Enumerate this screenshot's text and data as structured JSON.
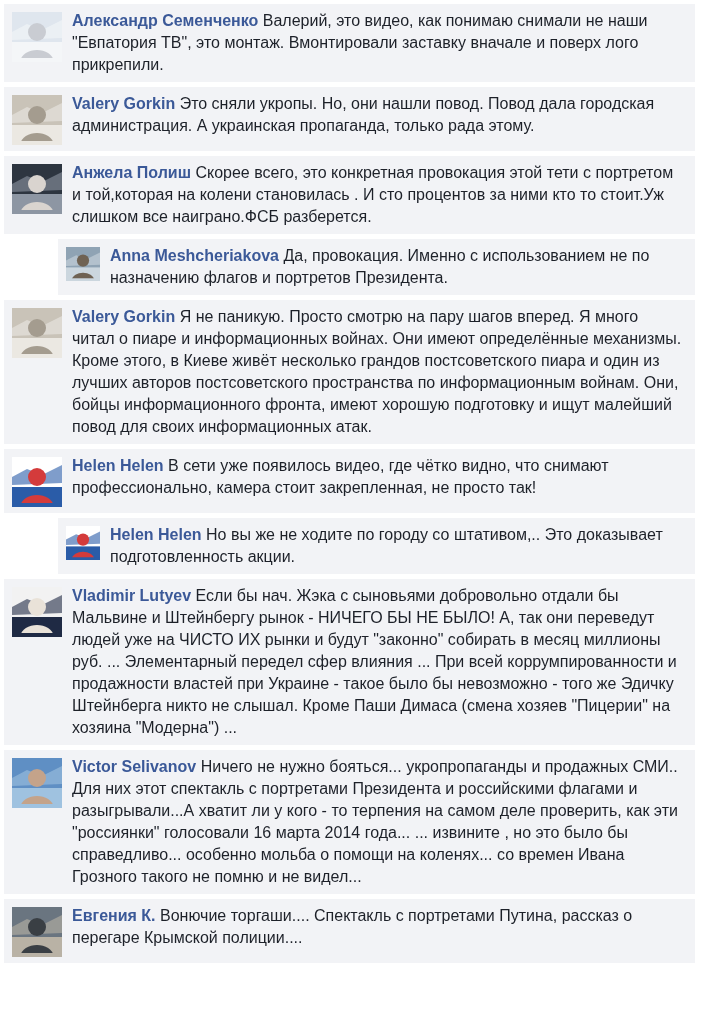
{
  "comments": [
    {
      "author": "Александр Семенченко",
      "text": "Валерий, это видео, как понимаю снимали не наши \"Евпатория ТВ\", это монтаж. Вмонтировали заставку вначале и поверх лого прикрепили.",
      "reply": false
    },
    {
      "author": "Valery Gorkin",
      "text": "Это сняли укропы. Но, они нашли повод. Повод дала городская администрация. А украинская пропаганда, только рада этому.",
      "reply": false
    },
    {
      "author": "Анжела Полиш",
      "text": "Скорее всего, это конкретная провокация этой тети с портретом и той,которая на колени становилась . И сто процентов за ними кто то стоит.Уж слишком все наиграно.ФСБ разберется.",
      "reply": false
    },
    {
      "author": "Anna Meshcheriakova",
      "text": "Да, провокация. Именно с использованием не по назначению флагов и портретов Президента.",
      "reply": true
    },
    {
      "author": "Valery Gorkin",
      "text": "Я не паникую. Просто смотрю на пару шагов вперед. Я много читал о пиаре и информационных войнах. Они имеют определённые механизмы. Кроме этого, в Киеве живёт несколько грандов постсоветского пиара и один из лучших авторов постсоветского пространства по информационным войнам. Они, бойцы информационного фронта, имеют хорошую подготовку и ищут малейший повод для своих информационных атак.",
      "reply": false
    },
    {
      "author": "Helen Helen",
      "text": "В сети уже появилось видео, где чётко видно, что снимают профессионально, камера стоит закрепленная, не просто так!",
      "reply": false
    },
    {
      "author": "Helen Helen",
      "text": "Но вы же не ходите по городу со штативом,.. Это доказывает подготовленность акции.",
      "reply": true
    },
    {
      "author": "Vladimir Lutyev",
      "text": "Если бы нач. Жэка с сыновьями добровольно отдали бы Мальвине и Штейнбергу рынок - НИЧЕГО БЫ НЕ БЫЛО! А, так они переведут людей уже на ЧИСТО ИХ рынки и будут \"законно\" собирать в месяц миллионы руб. ... Элементарный передел сфер влияния ... При всей коррумпированности и продажности властей при Украине - такое было бы невозможно - того же Эдичку Штейнберга никто не слышал. Кроме Паши Димаса (смена хозяев \"Пицерии\" на хозяина \"Модерна\") ...",
      "reply": false
    },
    {
      "author": "Victor Selivanov",
      "text": "Ничего не нужно бояться... укропропаганды и продажных СМИ.. Для них этот спектакль с портретами Президента и российскими флагами и разыгрывали...А хватит ли у кого - то терпения на самом деле проверить, как эти \"россиянки\" голосовали 16 марта 2014 года... ... извините , но это было бы справедливо... особенно мольба о помощи на коленях... со времен Ивана Грозного такого не помню и не видел...",
      "reply": false
    },
    {
      "author": "Евгения К.",
      "text": "Вонючие торгаши.... Спектакль с портретами Путина, рассказ о перегаре Крымской полиции....",
      "reply": false
    }
  ]
}
